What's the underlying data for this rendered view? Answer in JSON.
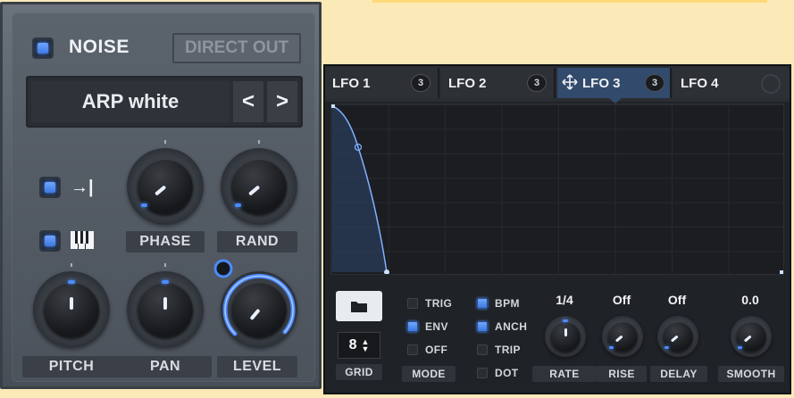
{
  "noise": {
    "title": "NOISE",
    "enabled": true,
    "direct_out_label": "DIRECT OUT",
    "preset_name": "ARP white",
    "prev_glyph": "<",
    "next_glyph": ">",
    "retrigger_icon": "→|",
    "keytrack_icon": "piano-keys",
    "knobs": {
      "phase": {
        "label": "PHASE"
      },
      "rand": {
        "label": "RAND"
      },
      "pitch": {
        "label": "PITCH"
      },
      "pan": {
        "label": "PAN"
      },
      "level": {
        "label": "LEVEL"
      }
    }
  },
  "lfo": {
    "tabs": [
      {
        "label": "LFO 1",
        "count": "3"
      },
      {
        "label": "LFO 2",
        "count": "3"
      },
      {
        "label": "LFO 3",
        "count": "3",
        "active": true
      },
      {
        "label": "LFO 4",
        "count": ""
      }
    ],
    "grid_value": "8",
    "grid_label": "GRID",
    "mode_label": "MODE",
    "options_col1": [
      {
        "label": "TRIG",
        "on": false
      },
      {
        "label": "ENV",
        "on": true
      },
      {
        "label": "OFF",
        "on": false
      }
    ],
    "options_col2": [
      {
        "label": "BPM",
        "on": true
      },
      {
        "label": "ANCH",
        "on": true
      },
      {
        "label": "TRIP",
        "on": false
      },
      {
        "label": "DOT",
        "on": false
      }
    ],
    "knobs": {
      "rate": {
        "label": "RATE",
        "value": "1/4"
      },
      "rise": {
        "label": "RISE",
        "value": "Off"
      },
      "delay": {
        "label": "DELAY",
        "value": "Off"
      },
      "smooth": {
        "label": "SMOOTH",
        "value": "0.0"
      }
    }
  },
  "colors": {
    "accent": "#4b8bff",
    "background": "#fbe9b7",
    "active_tab": "#324a6c"
  }
}
